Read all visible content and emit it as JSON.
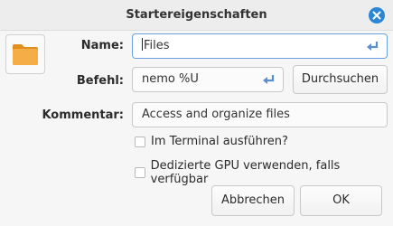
{
  "window": {
    "title": "Startereigenschaften",
    "close_icon": "close-icon",
    "accent_color": "#2b86d6"
  },
  "icon_button": {
    "icon": "folder-icon",
    "color": "#f2a93b"
  },
  "form": {
    "name_label": "Name:",
    "name_value": "Files",
    "command_label": "Befehl:",
    "command_value": "nemo %U",
    "browse_label": "Durchsuchen",
    "comment_label": "Kommentar:",
    "comment_value": "Access and organize files"
  },
  "options": {
    "terminal_label": "Im Terminal ausführen?",
    "terminal_checked": false,
    "gpu_label": "Dedizierte GPU verwenden, falls verfügbar",
    "gpu_checked": false
  },
  "actions": {
    "cancel_label": "Abbrechen",
    "ok_label": "OK"
  }
}
